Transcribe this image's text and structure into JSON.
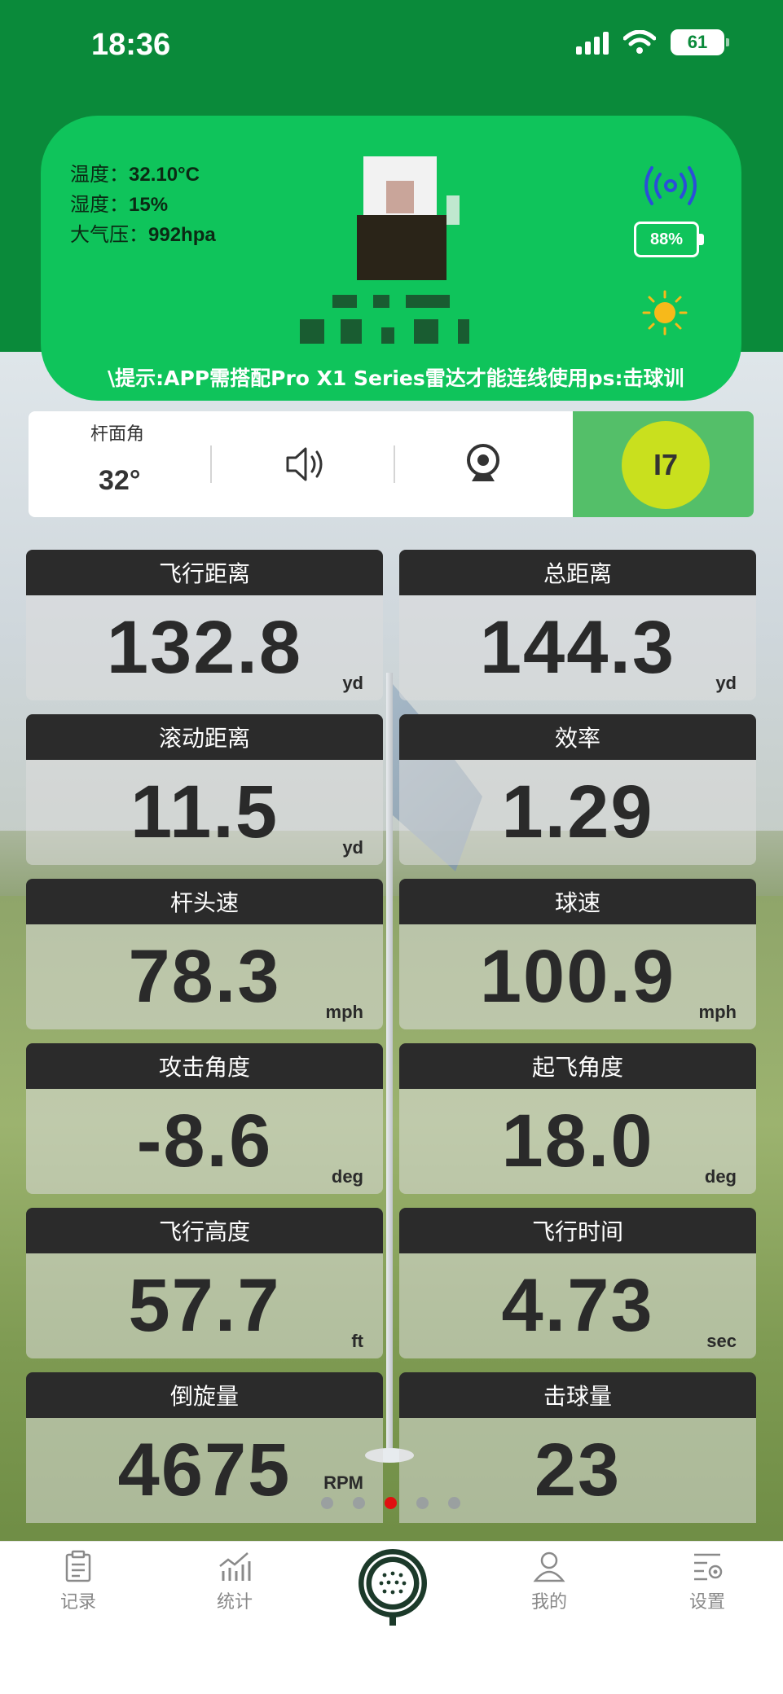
{
  "status_bar": {
    "time": "18:36",
    "battery": "61"
  },
  "header": {
    "env": [
      {
        "label": "温度：",
        "value": "32.10°C"
      },
      {
        "label": "湿度：",
        "value": "15%"
      },
      {
        "label": "大气压：",
        "value": "992hpa"
      }
    ],
    "device_battery": "88%",
    "tip": "\\提示:APP需搭配Pro X1 Series雷达才能连线使用ps:击球训"
  },
  "controls": {
    "angle_label": "杆面角",
    "angle_value": "32°",
    "club": "I7"
  },
  "metrics": [
    {
      "title": "飞行距离",
      "value": "132.8",
      "unit": "yd"
    },
    {
      "title": "总距离",
      "value": "144.3",
      "unit": "yd"
    },
    {
      "title": "滚动距离",
      "value": "11.5",
      "unit": "yd"
    },
    {
      "title": "效率",
      "value": "1.29",
      "unit": ""
    },
    {
      "title": "杆头速",
      "value": "78.3",
      "unit": "mph"
    },
    {
      "title": "球速",
      "value": "100.9",
      "unit": "mph"
    },
    {
      "title": "攻击角度",
      "value": "-8.6",
      "unit": "deg"
    },
    {
      "title": "起飞角度",
      "value": "18.0",
      "unit": "deg"
    },
    {
      "title": "飞行高度",
      "value": "57.7",
      "unit": "ft"
    },
    {
      "title": "飞行时间",
      "value": "4.73",
      "unit": "sec"
    },
    {
      "title": "倒旋量",
      "value": "4675",
      "unit": "RPM"
    },
    {
      "title": "击球量",
      "value": "23",
      "unit": ""
    }
  ],
  "pager": {
    "count": 5,
    "active_index": 2
  },
  "nav": {
    "records": "记录",
    "stats": "统计",
    "mine": "我的",
    "settings": "设置"
  },
  "colors": {
    "header_green": "#0a8a3a",
    "card_green": "#0fc45b",
    "club_panel": "#54bf69",
    "club_button": "#c9e01e",
    "metric_title_bg": "#2b2b2b",
    "active_dot": "#e01010"
  }
}
